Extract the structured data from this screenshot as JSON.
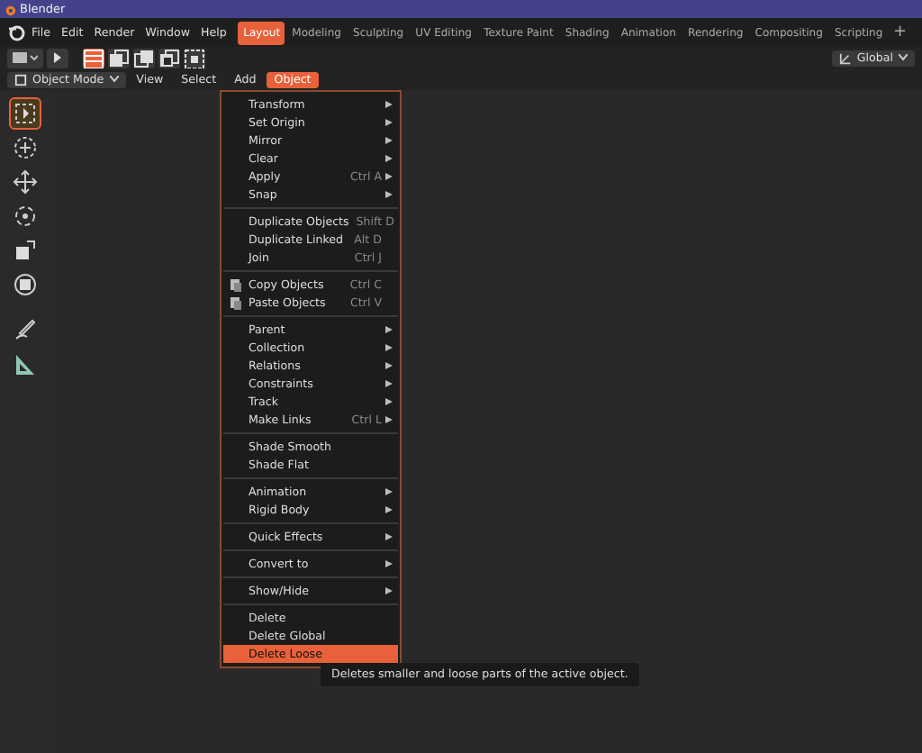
{
  "window": {
    "title": "Blender"
  },
  "menubar": [
    {
      "label": "File"
    },
    {
      "label": "Edit"
    },
    {
      "label": "Render"
    },
    {
      "label": "Window"
    },
    {
      "label": "Help"
    }
  ],
  "workspaces": [
    {
      "label": "Layout",
      "selected": true
    },
    {
      "label": "Modeling",
      "selected": false
    },
    {
      "label": "Sculpting",
      "selected": false
    },
    {
      "label": "UV Editing",
      "selected": false
    },
    {
      "label": "Texture Paint",
      "selected": false
    },
    {
      "label": "Shading",
      "selected": false
    },
    {
      "label": "Animation",
      "selected": false
    },
    {
      "label": "Rendering",
      "selected": false
    },
    {
      "label": "Compositing",
      "selected": false
    },
    {
      "label": "Scripting",
      "selected": false
    }
  ],
  "add_workspace": "+",
  "select_modes": [
    {
      "selected": true
    },
    {
      "selected": false
    },
    {
      "selected": false
    },
    {
      "selected": false
    },
    {
      "selected": false
    }
  ],
  "orientation": {
    "value": "Global"
  },
  "mode": {
    "value": "Object Mode"
  },
  "viewport_menus": [
    {
      "label": "View",
      "selected": false
    },
    {
      "label": "Select",
      "selected": false
    },
    {
      "label": "Add",
      "selected": false
    },
    {
      "label": "Object",
      "selected": true
    }
  ],
  "tools": [
    {
      "selected": true
    },
    {
      "selected": false
    },
    {
      "selected": false
    },
    {
      "selected": false
    },
    {
      "selected": false
    },
    {
      "selected": false
    },
    {
      "selected": false
    },
    {
      "selected": false
    }
  ],
  "menu": {
    "items": [
      {
        "kind": "item",
        "label": "Transform",
        "submenu": true,
        "selected": false
      },
      {
        "kind": "item",
        "label": "Set Origin",
        "submenu": true,
        "selected": false
      },
      {
        "kind": "item",
        "label": "Mirror",
        "submenu": true,
        "selected": false
      },
      {
        "kind": "item",
        "label": "Clear",
        "submenu": true,
        "selected": false
      },
      {
        "kind": "item",
        "label": "Apply",
        "shortcut": "Ctrl A",
        "submenu": true,
        "selected": false
      },
      {
        "kind": "item",
        "label": "Snap",
        "submenu": true,
        "selected": false
      },
      {
        "kind": "separator"
      },
      {
        "kind": "item",
        "label": "Duplicate Objects",
        "shortcut": "Shift D",
        "submenu": false,
        "selected": false
      },
      {
        "kind": "item",
        "label": "Duplicate Linked",
        "shortcut": "Alt D",
        "submenu": false,
        "selected": false
      },
      {
        "kind": "item",
        "label": "Join",
        "shortcut": "Ctrl J",
        "submenu": false,
        "selected": false
      },
      {
        "kind": "separator"
      },
      {
        "kind": "item",
        "label": "Copy Objects",
        "shortcut": "Ctrl C",
        "submenu": false,
        "icon": true,
        "selected": false
      },
      {
        "kind": "item",
        "label": "Paste Objects",
        "shortcut": "Ctrl V",
        "submenu": false,
        "icon": true,
        "selected": false
      },
      {
        "kind": "separator"
      },
      {
        "kind": "item",
        "label": "Parent",
        "submenu": true,
        "selected": false
      },
      {
        "kind": "item",
        "label": "Collection",
        "submenu": true,
        "selected": false
      },
      {
        "kind": "item",
        "label": "Relations",
        "submenu": true,
        "selected": false
      },
      {
        "kind": "item",
        "label": "Constraints",
        "submenu": true,
        "selected": false
      },
      {
        "kind": "item",
        "label": "Track",
        "submenu": true,
        "selected": false
      },
      {
        "kind": "item",
        "label": "Make Links",
        "shortcut": "Ctrl L",
        "submenu": true,
        "selected": false
      },
      {
        "kind": "separator"
      },
      {
        "kind": "item",
        "label": "Shade Smooth",
        "submenu": false,
        "selected": false
      },
      {
        "kind": "item",
        "label": "Shade Flat",
        "submenu": false,
        "selected": false
      },
      {
        "kind": "separator"
      },
      {
        "kind": "item",
        "label": "Animation",
        "submenu": true,
        "selected": false
      },
      {
        "kind": "item",
        "label": "Rigid Body",
        "submenu": true,
        "selected": false
      },
      {
        "kind": "separator"
      },
      {
        "kind": "item",
        "label": "Quick Effects",
        "submenu": true,
        "selected": false
      },
      {
        "kind": "separator"
      },
      {
        "kind": "item",
        "label": "Convert to",
        "submenu": true,
        "selected": false
      },
      {
        "kind": "separator"
      },
      {
        "kind": "item",
        "label": "Show/Hide",
        "submenu": true,
        "selected": false
      },
      {
        "kind": "separator"
      },
      {
        "kind": "item",
        "label": "Delete",
        "submenu": false,
        "selected": false
      },
      {
        "kind": "item",
        "label": "Delete Global",
        "submenu": false,
        "selected": false
      },
      {
        "kind": "item",
        "label": "Delete Loose",
        "submenu": false,
        "selected": true
      }
    ]
  },
  "tooltip": {
    "text": "Deletes smaller and loose parts of the active object."
  }
}
